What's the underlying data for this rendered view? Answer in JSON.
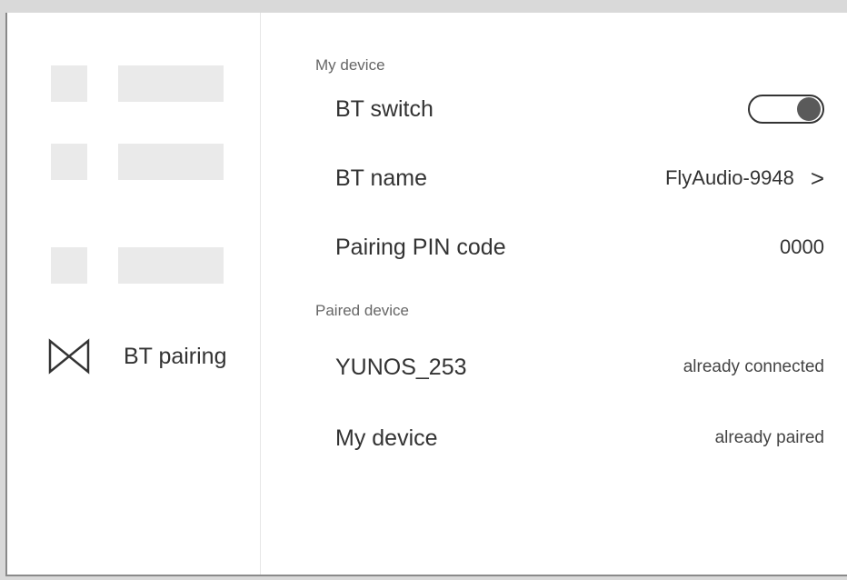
{
  "sidebar": {
    "active_item": {
      "icon": "bt-pairing-icon",
      "label": "BT pairing"
    }
  },
  "my_device_section": {
    "title": "My device",
    "bt_switch": {
      "label": "BT switch",
      "state": "on"
    },
    "bt_name": {
      "label": "BT name",
      "value": "FlyAudio-9948",
      "chevron": ">"
    },
    "pairing_pin": {
      "label": "Pairing PIN code",
      "value": "0000"
    }
  },
  "paired_device_section": {
    "title": "Paired device",
    "devices": [
      {
        "name": "YUNOS_253",
        "status": "already connected"
      },
      {
        "name": "My device",
        "status": "already paired"
      }
    ]
  }
}
